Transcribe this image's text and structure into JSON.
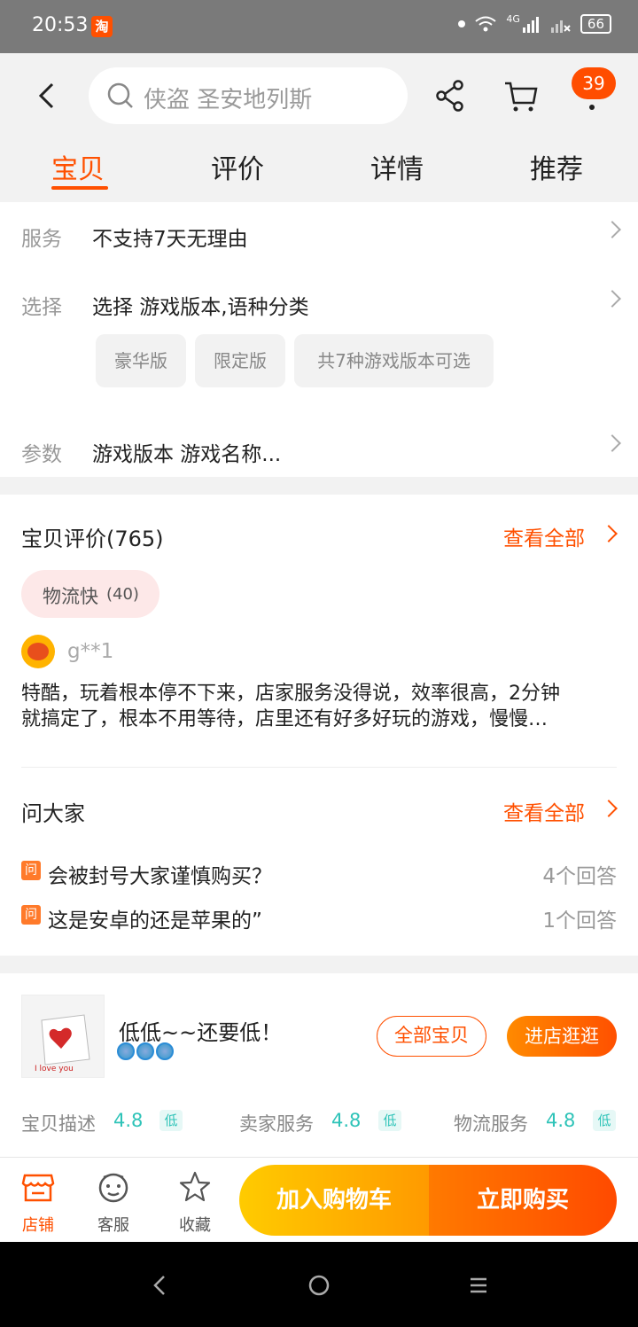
{
  "status_bar": {
    "time": "20:53",
    "app_badge": "淘",
    "network": "4G",
    "battery": "66"
  },
  "header": {
    "search_placeholder": "侠盗 圣安地列斯",
    "cart_badge": "39"
  },
  "tabs": [
    {
      "label": "宝贝",
      "active": true
    },
    {
      "label": "评价",
      "active": false
    },
    {
      "label": "详情",
      "active": false
    },
    {
      "label": "推荐",
      "active": false
    }
  ],
  "service": {
    "label": "服务",
    "value": "不支持7天无理由"
  },
  "select": {
    "label": "选择",
    "value": "选择 游戏版本,语种分类",
    "chips": [
      "豪华版",
      "限定版",
      "共7种游戏版本可选"
    ]
  },
  "params": {
    "label": "参数",
    "value": "游戏版本 游戏名称..."
  },
  "reviews": {
    "title": "宝贝评价(765)",
    "view_all": "查看全部",
    "tag_label": "物流快",
    "tag_count": "(40)",
    "reviewer": "g**1",
    "text_line1": "特酷，玩着根本停不下来，店家服务没得说，效率很高，2分钟",
    "text_line2": "就搞定了，根本不用等待，店里还有好多好玩的游戏，慢慢…"
  },
  "qa": {
    "title": "问大家",
    "view_all": "查看全部",
    "icon_text": "问",
    "items": [
      {
        "question": "会被封号大家谨慎购买？",
        "answers": "4个回答"
      },
      {
        "question": "这是安卓的还是苹果的”",
        "answers": "1个回答"
      }
    ]
  },
  "shop": {
    "name": "低低~~还要低！",
    "logo_text": "I love you",
    "all_items_button": "全部宝贝",
    "enter_shop_button": "进店逛逛",
    "ratings": [
      {
        "label": "宝贝描述",
        "score": "4.8",
        "level": "低"
      },
      {
        "label": "卖家服务",
        "score": "4.8",
        "level": "低"
      },
      {
        "label": "物流服务",
        "score": "4.8",
        "level": "低"
      }
    ]
  },
  "bottom_bar": {
    "shop": "店铺",
    "service": "客服",
    "favorite": "收藏",
    "add_to_cart": "加入购物车",
    "buy_now": "立即购买"
  },
  "colors": {
    "accent": "#ff5000",
    "rating": "#2ec3b8"
  }
}
